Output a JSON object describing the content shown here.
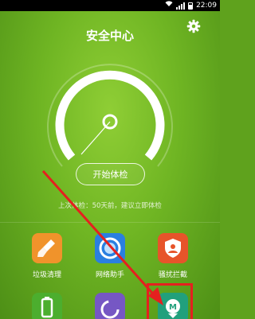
{
  "status_bar": {
    "time": "22:09"
  },
  "header": {
    "title": "安全中心"
  },
  "main": {
    "check_button": "开始体检",
    "hint": "上次体检：50天前，建议立即体检"
  },
  "tools": [
    {
      "label": "垃圾清理",
      "icon": "broom-icon",
      "color": "#f0932b"
    },
    {
      "label": "网络助手",
      "icon": "network-icon",
      "color": "#2a7fe0"
    },
    {
      "label": "骚扰拦截",
      "icon": "shield-user-icon",
      "color": "#e7542a"
    },
    {
      "label": "",
      "icon": "battery-icon",
      "color": "#4cae2e"
    },
    {
      "label": "",
      "icon": "permission-icon",
      "color": "#7657c4"
    },
    {
      "label": "",
      "icon": "m-badge-icon",
      "color": "#21a07c"
    }
  ],
  "accent": {
    "highlight": "#e5201f"
  }
}
